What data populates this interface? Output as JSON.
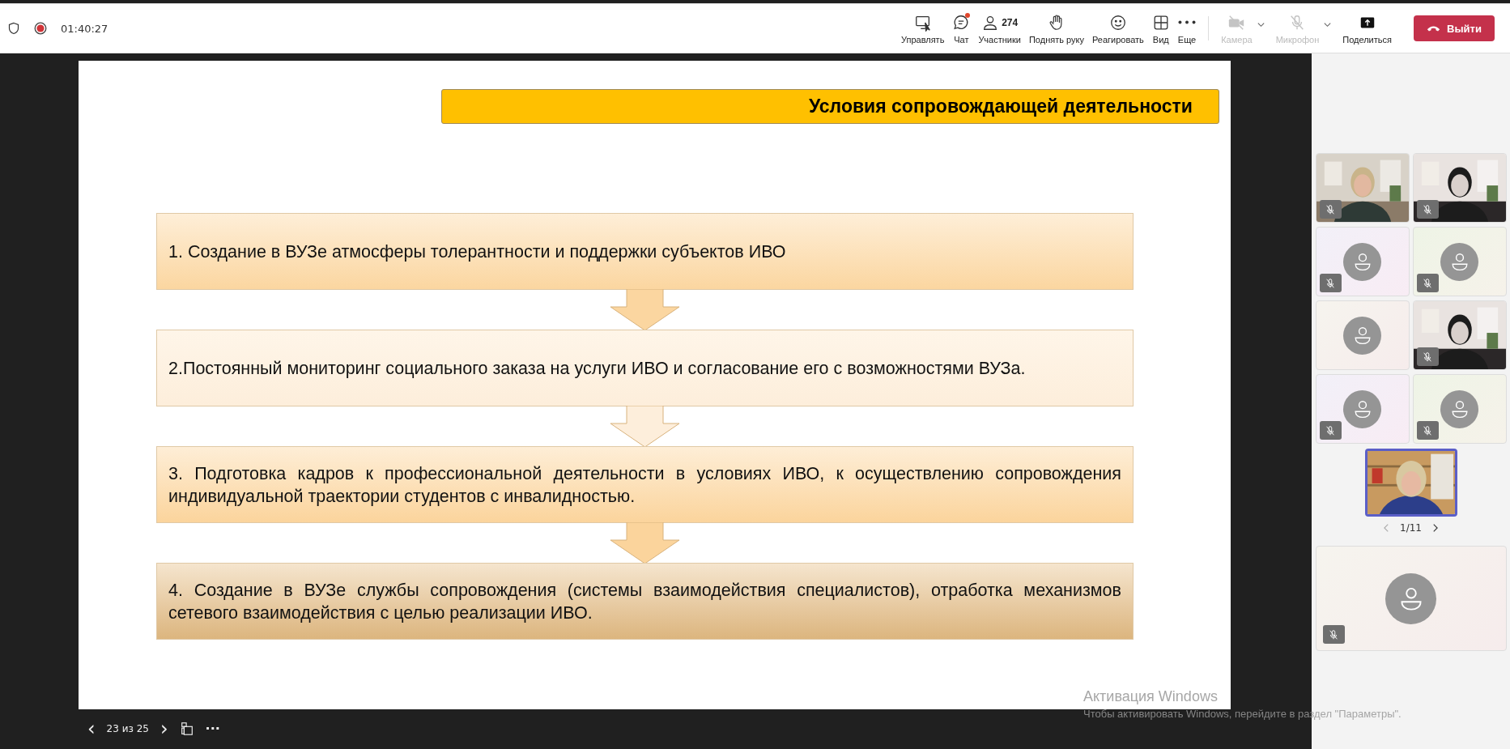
{
  "meeting_bar": {
    "timer": "01:40:27",
    "recording": true,
    "actions": [
      {
        "kind": "control",
        "label": "Управлять",
        "disabled": false,
        "notification": false
      },
      {
        "kind": "chat",
        "label": "Чат",
        "disabled": false,
        "notification": true
      },
      {
        "kind": "people",
        "label": "Участники",
        "count": "274",
        "disabled": false,
        "notification": false
      },
      {
        "kind": "hand",
        "label": "Поднять руку",
        "disabled": false,
        "notification": false
      },
      {
        "kind": "react",
        "label": "Реагировать",
        "disabled": false,
        "notification": false
      },
      {
        "kind": "view",
        "label": "Вид",
        "disabled": false,
        "notification": false
      },
      {
        "kind": "more",
        "label": "Еще",
        "disabled": false,
        "notification": false
      },
      {
        "kind": "camera",
        "label": "Камера",
        "disabled": true,
        "notification": false,
        "dropdown": true
      },
      {
        "kind": "mic",
        "label": "Микрофон",
        "disabled": true,
        "notification": false,
        "dropdown": true
      },
      {
        "kind": "share",
        "label": "Поделиться",
        "disabled": false,
        "notification": false
      }
    ],
    "leave_button": "Выйти"
  },
  "slide": {
    "title": "Условия сопровождающей деятельности",
    "steps": [
      {
        "text": "1. Создание в ВУЗе атмосферы толерантности и поддержки субъектов ИВО",
        "color": "#fbd6a0"
      },
      {
        "text": "2.Постоянный мониторинг социального заказа на услуги ИВО и согласование его с возможностями ВУЗа.",
        "color": "#fdeedb"
      },
      {
        "text": "3. Подготовка кадров к профессиональной деятельности в условиях ИВО, к осуществлению сопровождения индивидуальной траектории студентов с инвалидностью.",
        "color": "#fbd49c"
      },
      {
        "text": "4. Создание в ВУЗе службы сопровождения (системы взаимодействия специалистов), отработка механизмов сетевого взаимодействия с целью реализации ИВО.",
        "color": "#dcb57e"
      }
    ]
  },
  "slide_nav": {
    "prev": "‹",
    "counter": "23 из 25",
    "next": "›",
    "more": "···"
  },
  "participants": {
    "tiles": [
      {
        "kind": "video",
        "muted": true,
        "active_speaker": false
      },
      {
        "kind": "video",
        "muted": true,
        "active_speaker": false
      },
      {
        "kind": "avatar",
        "muted": true,
        "active_speaker": false
      },
      {
        "kind": "avatar",
        "muted": true,
        "active_speaker": false
      },
      {
        "kind": "avatar",
        "muted": false,
        "active_speaker": false
      },
      {
        "kind": "video",
        "muted": true,
        "active_speaker": false
      },
      {
        "kind": "avatar",
        "muted": true,
        "active_speaker": false
      },
      {
        "kind": "avatar",
        "muted": true,
        "active_speaker": false
      }
    ],
    "self_view": {
      "kind": "video",
      "muted": false,
      "active_speaker": true
    },
    "pager": "1/11",
    "spotlight": {
      "kind": "avatar",
      "muted": true,
      "active_speaker": false
    }
  },
  "os_notice": {
    "title": "Активация Windows",
    "text": "Чтобы активировать Windows, перейдите в раздел \"Параметры\"."
  }
}
